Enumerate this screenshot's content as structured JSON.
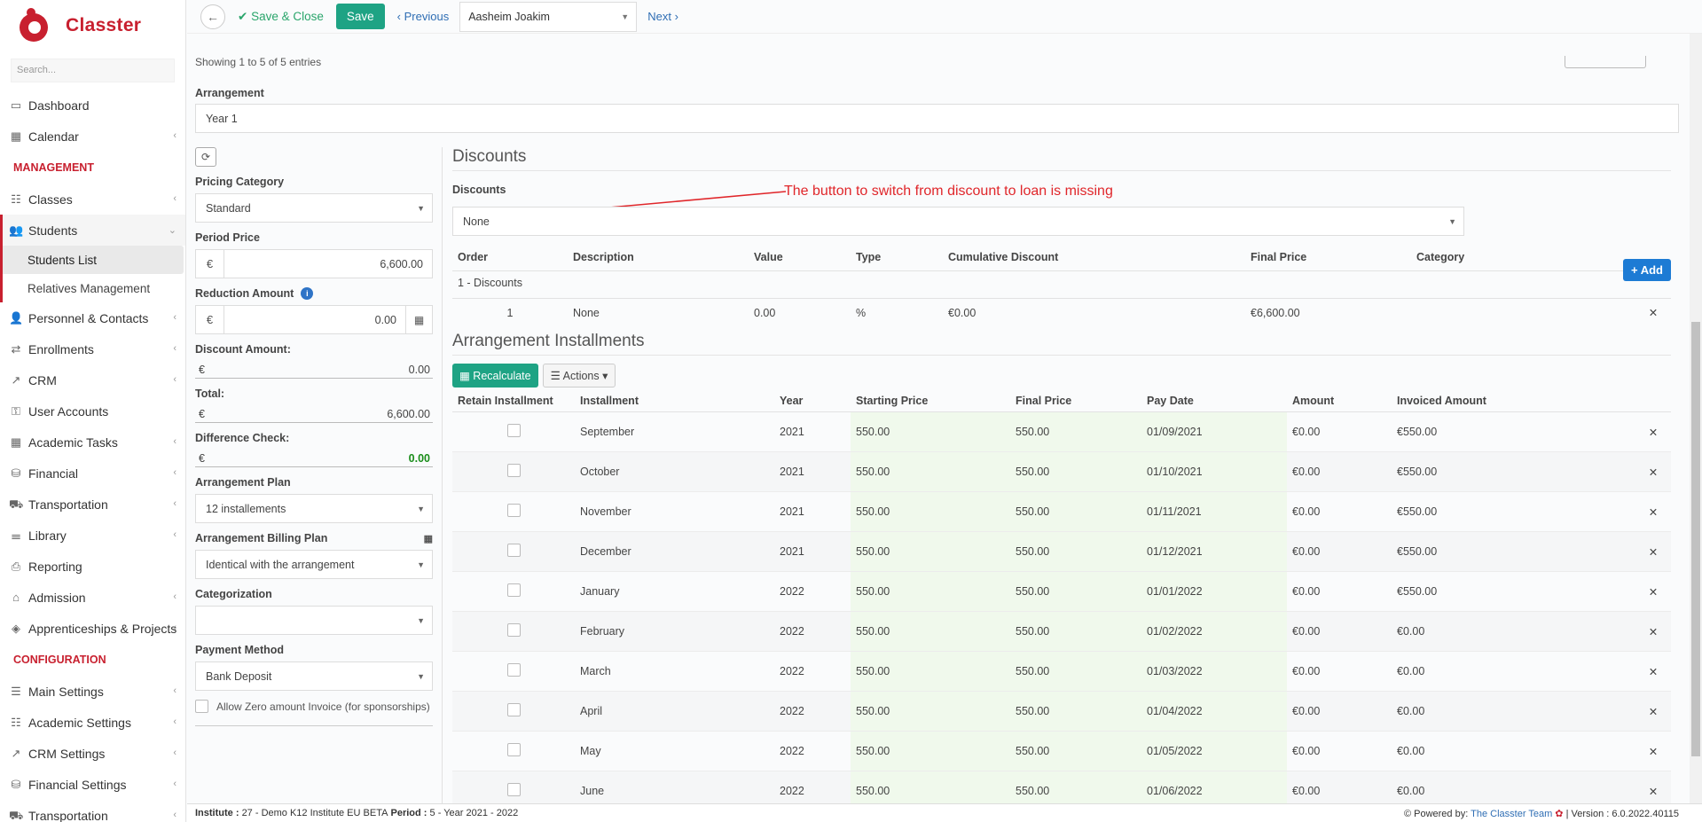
{
  "app": {
    "name": "Classter"
  },
  "sidebar": {
    "search_placeholder": "Search...",
    "items_top": [
      {
        "label": "Dashboard",
        "icon": "laptop-icon"
      },
      {
        "label": "Calendar",
        "icon": "calendar-icon",
        "chevron": true
      }
    ],
    "management_header": "MANAGEMENT",
    "management_items": [
      {
        "label": "Classes",
        "icon": "classes-icon",
        "chevron": true
      }
    ],
    "students": {
      "label": "Students",
      "sub_items": [
        "Students List",
        "Relatives Management"
      ]
    },
    "management_items_2": [
      {
        "label": "Personnel & Contacts",
        "chevron": true
      },
      {
        "label": "Enrollments",
        "chevron": true
      },
      {
        "label": "CRM",
        "chevron": true
      },
      {
        "label": "User Accounts",
        "chevron": false
      },
      {
        "label": "Academic Tasks",
        "chevron": true
      },
      {
        "label": "Financial",
        "chevron": true
      },
      {
        "label": "Transportation",
        "chevron": true
      },
      {
        "label": "Library",
        "chevron": true
      },
      {
        "label": "Reporting",
        "chevron": false
      },
      {
        "label": "Admission",
        "chevron": true
      },
      {
        "label": "Apprenticeships & Projects",
        "chevron": true
      }
    ],
    "configuration_header": "CONFIGURATION",
    "configuration_items": [
      {
        "label": "Main Settings",
        "chevron": true
      },
      {
        "label": "Academic Settings",
        "chevron": true
      },
      {
        "label": "CRM Settings",
        "chevron": true
      },
      {
        "label": "Financial Settings",
        "chevron": true
      },
      {
        "label": "Transportation",
        "chevron": true
      }
    ]
  },
  "toolbar": {
    "save_close_label": "Save & Close",
    "save_label": "Save",
    "previous_label": "Previous",
    "student_name": "Aasheim Joakim",
    "next_label": "Next"
  },
  "main": {
    "showing_text": "Showing 1 to 5 of 5 entries",
    "arrangement_label": "Arrangement",
    "arrangement_value": "Year 1"
  },
  "left_panel": {
    "pricing_category_label": "Pricing Category",
    "pricing_category_value": "Standard",
    "period_price_label": "Period Price",
    "currency": "€",
    "period_price_value": "6,600.00",
    "reduction_amount_label": "Reduction Amount",
    "reduction_amount_value": "0.00",
    "discount_amount_label": "Discount Amount:",
    "discount_amount_value": "0.00",
    "total_label": "Total:",
    "total_value": "6,600.00",
    "difference_check_label": "Difference Check:",
    "difference_check_value": "0.00",
    "arrangement_plan_label": "Arrangement Plan",
    "arrangement_plan_value": "12 installements",
    "billing_plan_label": "Arrangement Billing Plan",
    "billing_plan_value": "Identical with the arrangement",
    "categorization_label": "Categorization",
    "categorization_value": "",
    "payment_method_label": "Payment Method",
    "payment_method_value": "Bank Deposit",
    "allow_zero_label": "Allow Zero amount Invoice (for sponsorships)"
  },
  "discounts": {
    "title": "Discounts",
    "annotation": "The button to switch from discount to loan is missing",
    "field_label": "Discounts",
    "field_value": "None",
    "add_label": "Add",
    "columns": [
      "Order",
      "Description",
      "Value",
      "Type",
      "Cumulative Discount",
      "Final Price",
      "Category"
    ],
    "group_label": "1 - Discounts",
    "rows": [
      {
        "order": "1",
        "description": "None",
        "value": "0.00",
        "type": "%",
        "cumulative": "€0.00",
        "final_price": "€6,600.00",
        "category": ""
      }
    ]
  },
  "installments": {
    "title": "Arrangement Installments",
    "recalculate_label": "Recalculate",
    "actions_label": "Actions",
    "columns": [
      "Retain Installment",
      "Installment",
      "Year",
      "Starting Price",
      "Final Price",
      "Pay Date",
      "Amount",
      "Invoiced Amount"
    ],
    "rows": [
      {
        "installment": "September",
        "year": "2021",
        "starting": "550.00",
        "final": "550.00",
        "pay_date": "01/09/2021",
        "amount": "€0.00",
        "invoiced": "€550.00"
      },
      {
        "installment": "October",
        "year": "2021",
        "starting": "550.00",
        "final": "550.00",
        "pay_date": "01/10/2021",
        "amount": "€0.00",
        "invoiced": "€550.00"
      },
      {
        "installment": "November",
        "year": "2021",
        "starting": "550.00",
        "final": "550.00",
        "pay_date": "01/11/2021",
        "amount": "€0.00",
        "invoiced": "€550.00"
      },
      {
        "installment": "December",
        "year": "2021",
        "starting": "550.00",
        "final": "550.00",
        "pay_date": "01/12/2021",
        "amount": "€0.00",
        "invoiced": "€550.00"
      },
      {
        "installment": "January",
        "year": "2022",
        "starting": "550.00",
        "final": "550.00",
        "pay_date": "01/01/2022",
        "amount": "€0.00",
        "invoiced": "€550.00"
      },
      {
        "installment": "February",
        "year": "2022",
        "starting": "550.00",
        "final": "550.00",
        "pay_date": "01/02/2022",
        "amount": "€0.00",
        "invoiced": "€0.00"
      },
      {
        "installment": "March",
        "year": "2022",
        "starting": "550.00",
        "final": "550.00",
        "pay_date": "01/03/2022",
        "amount": "€0.00",
        "invoiced": "€0.00"
      },
      {
        "installment": "April",
        "year": "2022",
        "starting": "550.00",
        "final": "550.00",
        "pay_date": "01/04/2022",
        "amount": "€0.00",
        "invoiced": "€0.00"
      },
      {
        "installment": "May",
        "year": "2022",
        "starting": "550.00",
        "final": "550.00",
        "pay_date": "01/05/2022",
        "amount": "€0.00",
        "invoiced": "€0.00"
      },
      {
        "installment": "June",
        "year": "2022",
        "starting": "550.00",
        "final": "550.00",
        "pay_date": "01/06/2022",
        "amount": "€0.00",
        "invoiced": "€0.00"
      }
    ]
  },
  "status": {
    "institute_label": "Institute :",
    "institute_value": "27 - Demo K12 Institute EU BETA",
    "period_label": "Period :",
    "period_value": "5 - Year 2021 - 2022",
    "powered_by": "Powered by:",
    "team": "The Classter Team",
    "version": "| Version : 6.0.2022.40115"
  },
  "colors": {
    "brand": "#c8202f",
    "accent_green": "#1ea384",
    "link": "#2f6eb4",
    "delete": "#e0262a"
  }
}
